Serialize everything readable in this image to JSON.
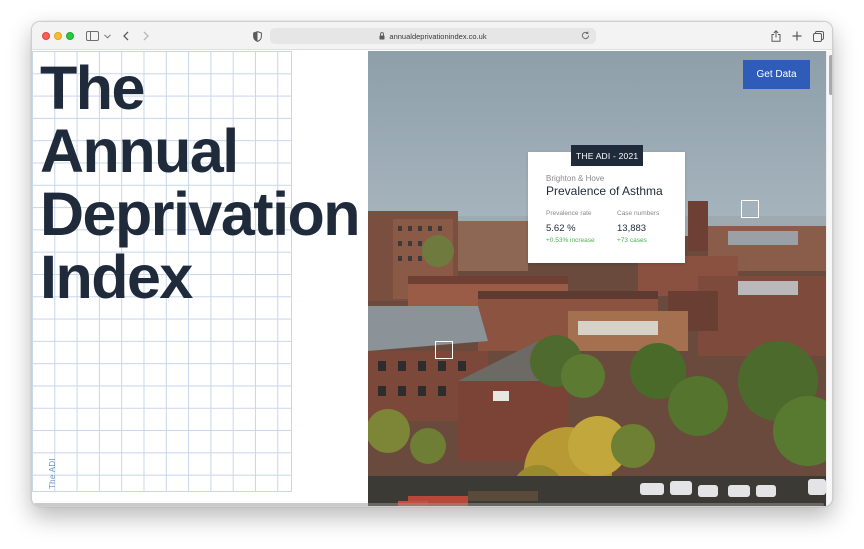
{
  "browser": {
    "url": "annualdeprivationindex.co.uk",
    "icons": [
      "sidebar-icon",
      "chevron-down-icon",
      "back-arrow-icon",
      "forward-arrow-icon",
      "shield-icon",
      "lock-icon",
      "reload-icon",
      "share-icon",
      "plus-icon",
      "tabs-icon"
    ]
  },
  "hero": {
    "title_lines": [
      "The",
      "Annual",
      "Deprivation",
      "Index"
    ],
    "vertical_label": "The ADI"
  },
  "header": {
    "cta_label": "Get Data"
  },
  "card": {
    "badge": "THE ADI - 2021",
    "region": "Brighton & Hove",
    "title": "Prevalence of Asthma",
    "stats": [
      {
        "label": "Prevalence rate",
        "value": "5.62 %",
        "change": "+0.53% increase"
      },
      {
        "label": "Case numbers",
        "value": "13,883",
        "change": "+73 cases"
      }
    ]
  },
  "colors": {
    "accent_blue": "#2e5cb8",
    "dark_navy": "#1f2a3a",
    "positive_green": "#4caf50",
    "grid_line": "#c8d6ec"
  }
}
